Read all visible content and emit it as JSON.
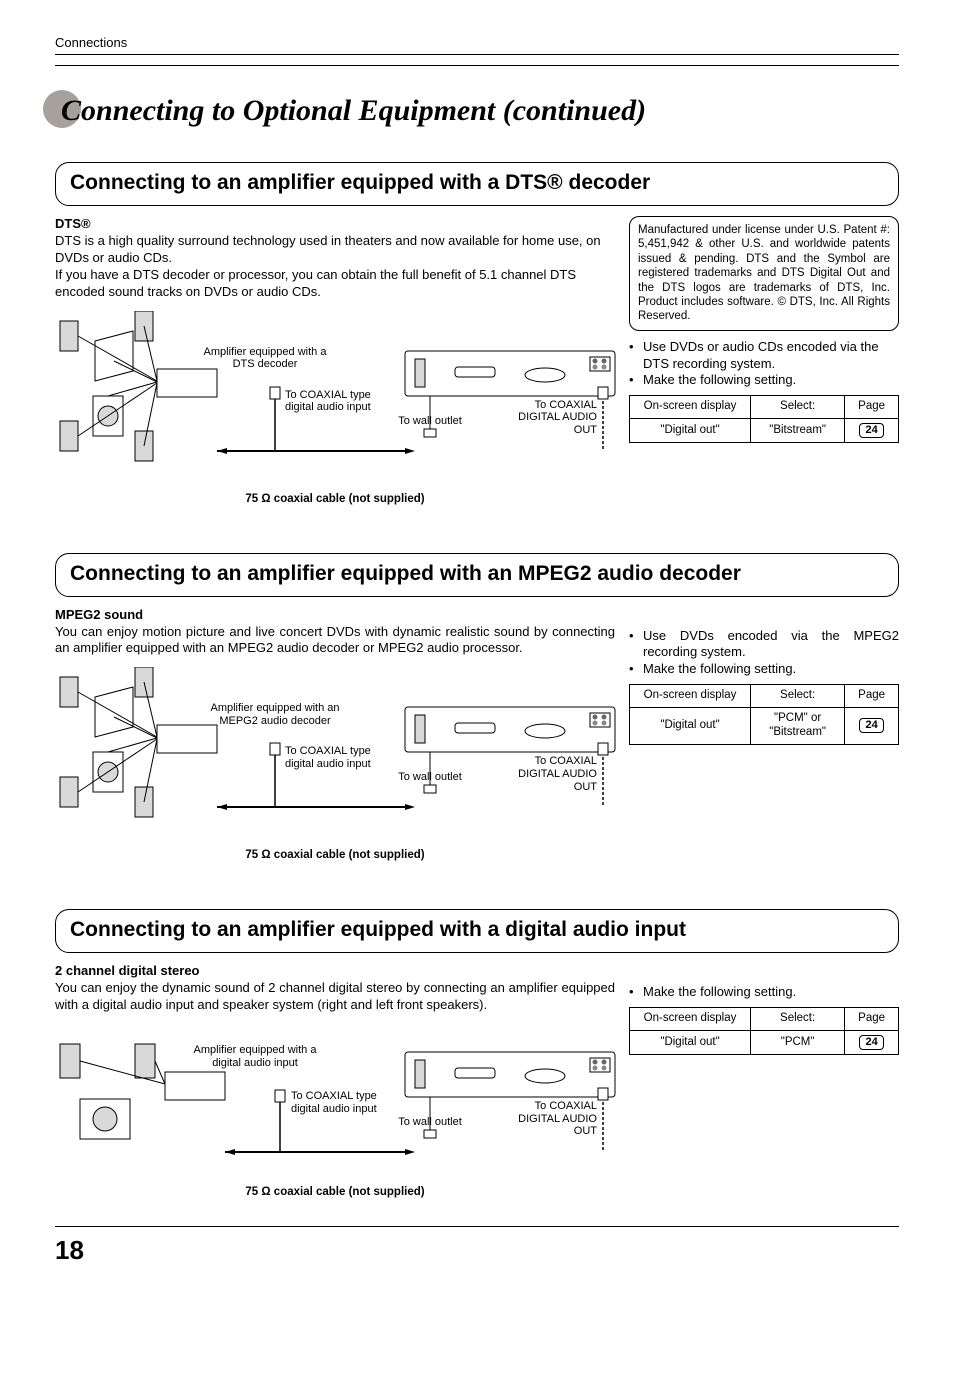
{
  "header": {
    "section_label": "Connections",
    "page_title": "Connecting to Optional Equipment (continued)"
  },
  "sections": [
    {
      "title": "Connecting to an amplifier equipped with a DTS® decoder",
      "subhead": "DTS®",
      "body": "DTS is a high quality surround technology used in theaters and now available for home use, on DVDs or audio CDs.\nIf you have a DTS decoder or processor, you can obtain the full benefit of 5.1 channel DTS encoded sound tracks on DVDs or audio CDs.",
      "legal": "Manufactured under license under U.S. Patent #: 5,451,942 & other U.S. and worldwide patents issued & pending. DTS and the Symbol are registered trademarks and DTS Digital Out and the DTS logos are trademarks of DTS, Inc. Product includes software. © DTS, Inc. All Rights Reserved.",
      "bullets": [
        "Use DVDs or audio CDs encoded via the DTS recording system.",
        "Make the following setting."
      ],
      "table": {
        "header": {
          "c1": "On-screen display",
          "c2": "Select:",
          "c3": "Page"
        },
        "row": {
          "c1": "\"Digital out\"",
          "c2": "\"Bitstream\"",
          "c3": "24"
        }
      },
      "diagram": {
        "amp_label": "Amplifier equipped with a DTS decoder",
        "input_label": "To COAXIAL type digital audio input",
        "wall_label": "To wall outlet",
        "out_label": "To COAXIAL DIGITAL AUDIO OUT",
        "cable_label": "75 Ω coaxial cable (not supplied)"
      },
      "speakers": 6
    },
    {
      "title": "Connecting to an amplifier equipped with an MPEG2 audio decoder",
      "subhead": "MPEG2 sound",
      "body": "You can enjoy motion picture and live concert DVDs with dynamic realistic sound by connecting an amplifier equipped with an MPEG2 audio decoder or MPEG2 audio processor.",
      "bullets": [
        "Use DVDs encoded via the MPEG2 recording system.",
        "Make the following setting."
      ],
      "table": {
        "header": {
          "c1": "On-screen display",
          "c2": "Select:",
          "c3": "Page"
        },
        "row": {
          "c1": "\"Digital out\"",
          "c2": "\"PCM\" or \"Bitstream\"",
          "c3": "24"
        }
      },
      "diagram": {
        "amp_label": "Amplifier equipped with an MEPG2 audio decoder",
        "input_label": "To COAXIAL type digital audio input",
        "wall_label": "To wall outlet",
        "out_label": "To COAXIAL DIGITAL AUDIO OUT",
        "cable_label": "75 Ω coaxial cable (not supplied)"
      },
      "speakers": 6
    },
    {
      "title": "Connecting to an amplifier equipped with a digital audio input",
      "subhead": "2 channel digital stereo",
      "body": "You can enjoy the dynamic sound of 2 channel digital stereo by connecting an amplifier equipped with a digital audio input and speaker system (right and left front speakers).",
      "bullets": [
        "Make the following setting."
      ],
      "table": {
        "header": {
          "c1": "On-screen display",
          "c2": "Select:",
          "c3": "Page"
        },
        "row": {
          "c1": "\"Digital out\"",
          "c2": "\"PCM\"",
          "c3": "24"
        }
      },
      "diagram": {
        "amp_label": "Amplifier equipped with a digital audio input",
        "input_label": "To COAXIAL type digital audio input",
        "wall_label": "To wall outlet",
        "out_label": "To COAXIAL DIGITAL AUDIO OUT",
        "cable_label": "75 Ω coaxial cable (not supplied)"
      },
      "speakers": 2
    }
  ],
  "page_number": "18"
}
